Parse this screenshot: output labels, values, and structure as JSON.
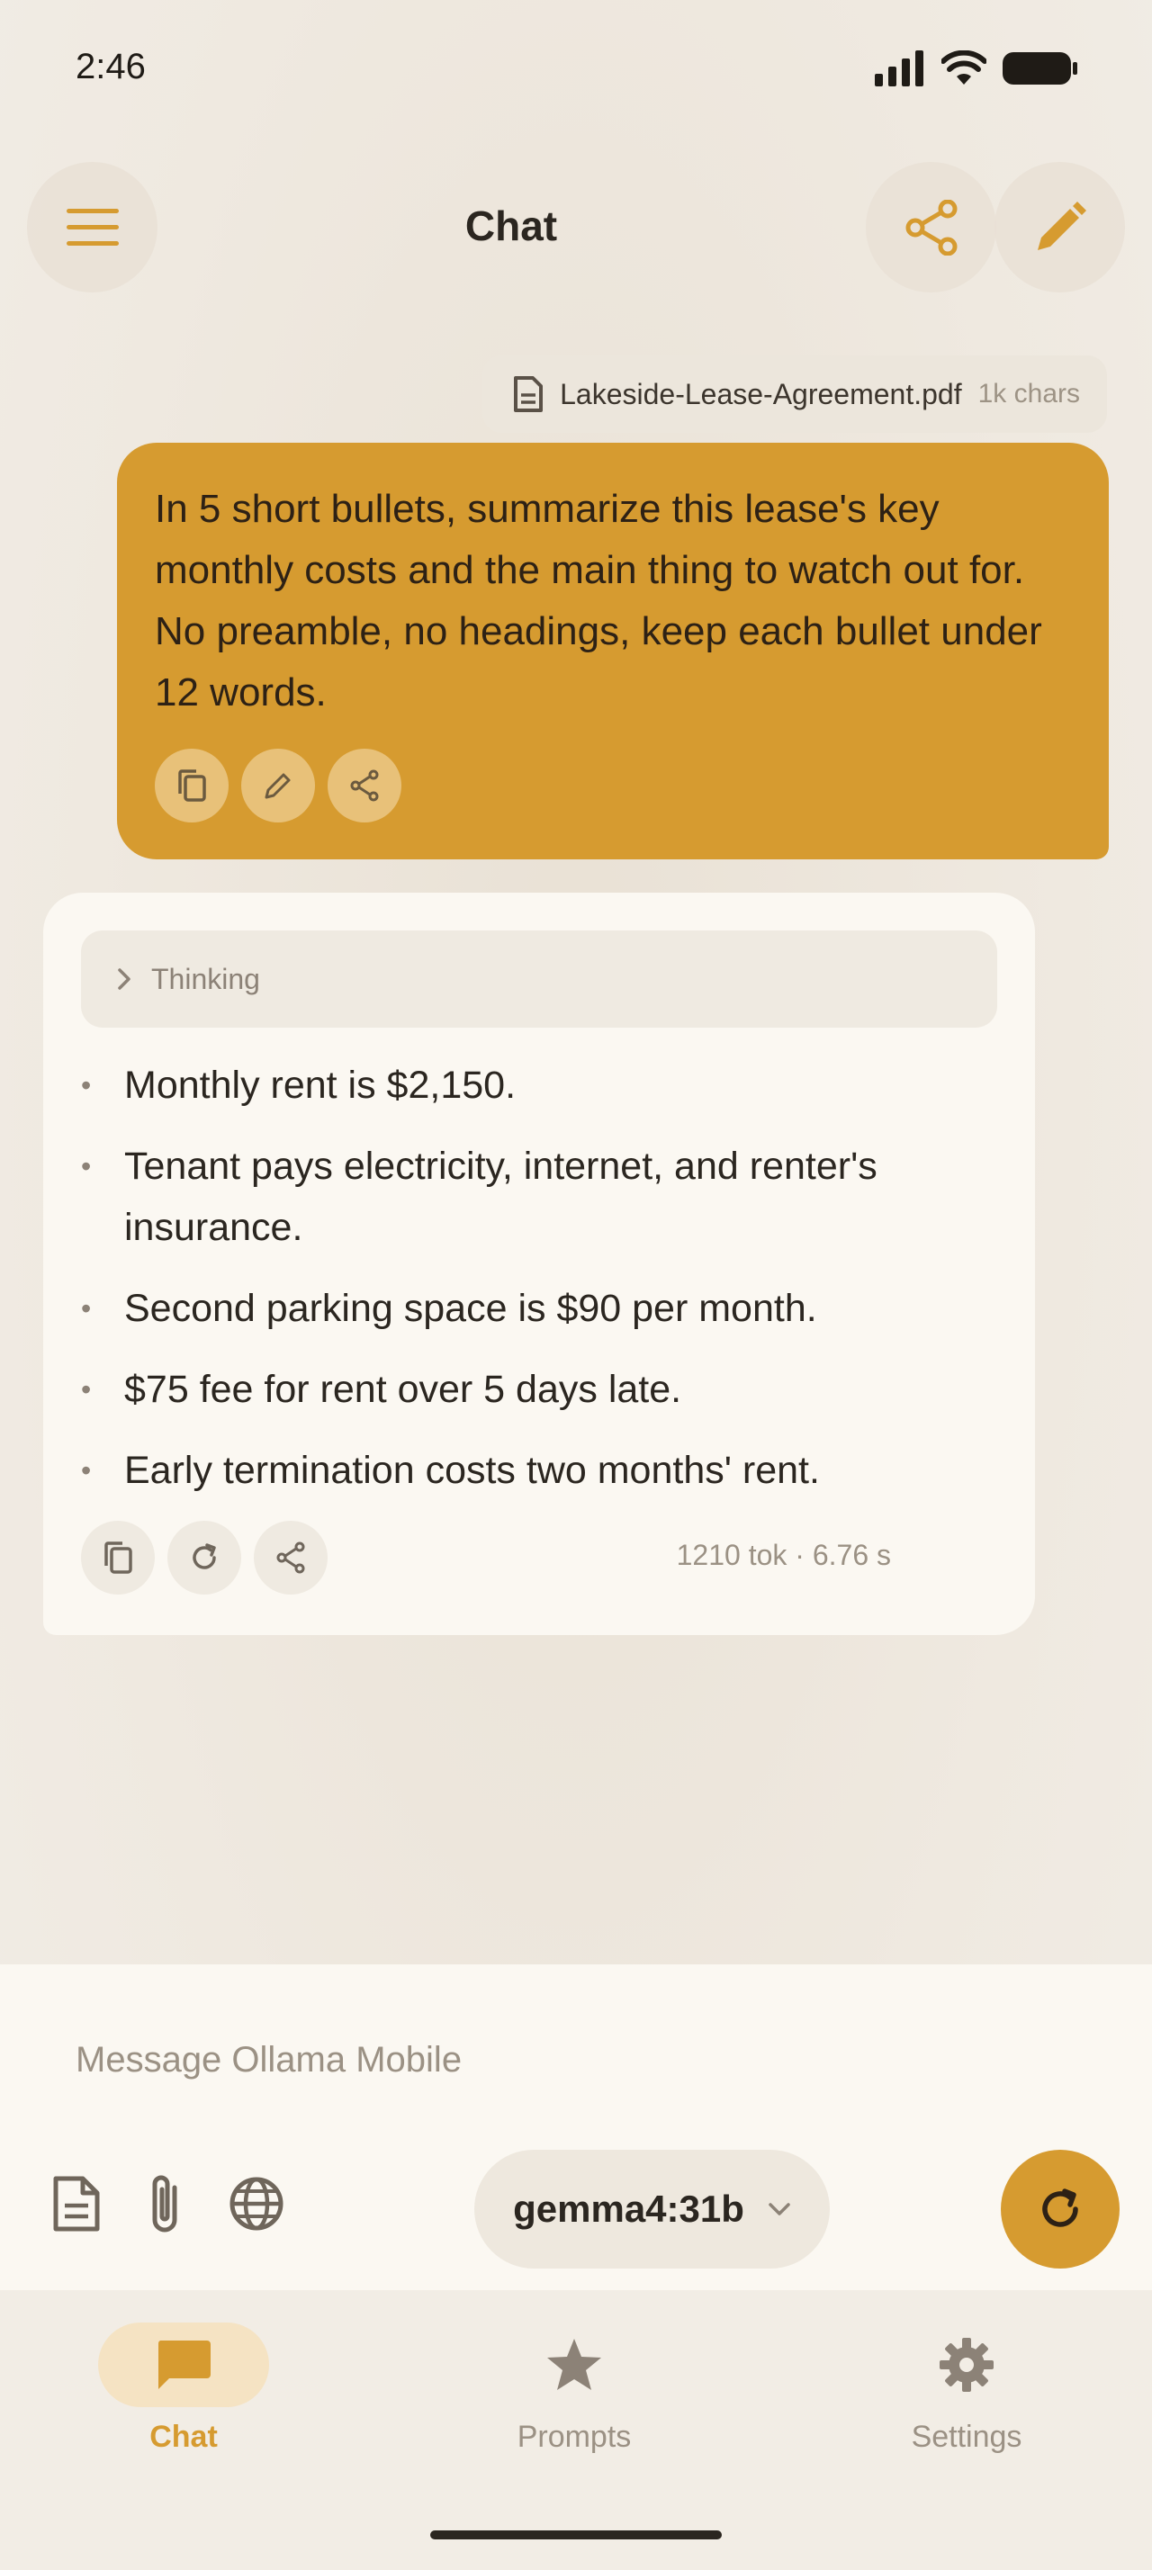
{
  "status_bar": {
    "time": "2:46"
  },
  "header": {
    "title": "Chat"
  },
  "attachment": {
    "name": "Lakeside-Lease-Agreement.pdf",
    "size": "1k chars"
  },
  "user_message": {
    "text": "In 5 short bullets, summarize this lease's key monthly costs and the main thing to watch out for. No preamble, no headings, keep each bullet under 12 words."
  },
  "assistant_message": {
    "thinking_label": "Thinking",
    "bullets": [
      "Monthly rent is $2,150.",
      "Tenant pays electricity, internet, and renter's insurance.",
      "Second parking space is $90 per month.",
      "$75 fee for rent over 5 days late.",
      "Early termination costs two months' rent."
    ],
    "stats": "1210 tok · 6.76 s"
  },
  "composer": {
    "placeholder": "Message Ollama Mobile",
    "model": "gemma4:31b"
  },
  "bottom_nav": {
    "items": [
      {
        "label": "Chat",
        "icon": "chat-icon",
        "active": true
      },
      {
        "label": "Prompts",
        "icon": "star-icon",
        "active": false
      },
      {
        "label": "Settings",
        "icon": "gear-icon",
        "active": false
      }
    ]
  },
  "colors": {
    "accent": "#d69b30",
    "background": "#efe9e0",
    "card": "#fbf8f2",
    "muted_text": "#9b9184"
  }
}
